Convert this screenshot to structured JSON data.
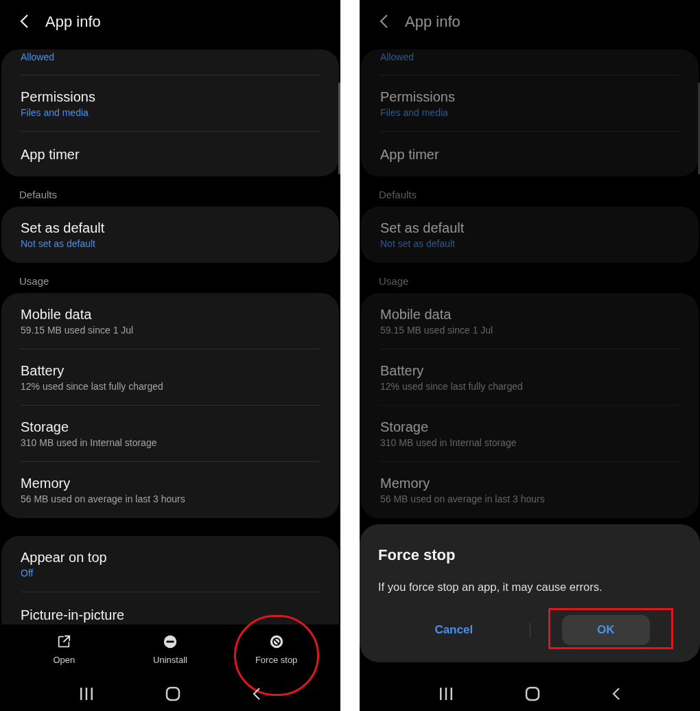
{
  "screens": [
    {
      "title": "App info",
      "dimmed": false,
      "sections": [
        {
          "cards": [
            {
              "rows": [
                {
                  "kind": "partial",
                  "subtitle": "Allowed",
                  "accent": true
                },
                {
                  "kind": "item",
                  "title": "Permissions",
                  "subtitle": "Files and media",
                  "accent": true
                },
                {
                  "kind": "item",
                  "title": "App timer"
                }
              ]
            }
          ]
        },
        {
          "label": "Defaults",
          "cards": [
            {
              "rows": [
                {
                  "kind": "item",
                  "title": "Set as default",
                  "subtitle": "Not set as default",
                  "accent": true
                }
              ]
            }
          ]
        },
        {
          "label": "Usage",
          "cards": [
            {
              "rows": [
                {
                  "kind": "item",
                  "title": "Mobile data",
                  "subtitle": "59.15 MB used since 1 Jul",
                  "accent": false
                },
                {
                  "kind": "item",
                  "title": "Battery",
                  "subtitle": "12% used since last fully charged",
                  "accent": false
                },
                {
                  "kind": "item",
                  "title": "Storage",
                  "subtitle": "310 MB used in Internal storage",
                  "accent": false
                },
                {
                  "kind": "item",
                  "title": "Memory",
                  "subtitle": "56 MB used on average in last 3 hours",
                  "accent": false
                }
              ]
            },
            {
              "rows": [
                {
                  "kind": "item",
                  "title": "Appear on top",
                  "subtitle": "Off",
                  "accent": true
                },
                {
                  "kind": "item",
                  "title": "Picture-in-picture"
                }
              ]
            }
          ]
        }
      ],
      "actions": [
        {
          "kind": "open",
          "label": "Open",
          "highlighted": false
        },
        {
          "kind": "uninstall",
          "label": "Uninstall",
          "highlighted": false
        },
        {
          "kind": "stop",
          "label": "Force stop",
          "highlighted": true
        }
      ]
    },
    {
      "title": "App info",
      "dimmed": true,
      "sections": [
        {
          "cards": [
            {
              "rows": [
                {
                  "kind": "partial",
                  "subtitle": "Allowed",
                  "accent": true
                },
                {
                  "kind": "item",
                  "title": "Permissions",
                  "subtitle": "Files and media",
                  "accent": true
                },
                {
                  "kind": "item",
                  "title": "App timer"
                }
              ]
            }
          ]
        },
        {
          "label": "Defaults",
          "cards": [
            {
              "rows": [
                {
                  "kind": "item",
                  "title": "Set as default",
                  "subtitle": "Not set as default",
                  "accent": true
                }
              ]
            }
          ]
        },
        {
          "label": "Usage",
          "cards": [
            {
              "rows": [
                {
                  "kind": "item",
                  "title": "Mobile data",
                  "subtitle": "59.15 MB used since 1 Jul",
                  "accent": false
                },
                {
                  "kind": "item",
                  "title": "Battery",
                  "subtitle": "12% used since last fully charged",
                  "accent": false
                },
                {
                  "kind": "item",
                  "title": "Storage",
                  "subtitle": "310 MB used in Internal storage",
                  "accent": false
                },
                {
                  "kind": "item",
                  "title": "Memory",
                  "subtitle": "56 MB used on average in last 3 hours",
                  "accent": false
                }
              ]
            }
          ]
        }
      ],
      "dialog": {
        "title": "Force stop",
        "message": "If you force stop an app, it may cause errors.",
        "buttons": [
          {
            "label": "Cancel",
            "pressed": false,
            "highlighted": false
          },
          {
            "label": "OK",
            "pressed": true,
            "highlighted": true
          }
        ]
      }
    }
  ]
}
